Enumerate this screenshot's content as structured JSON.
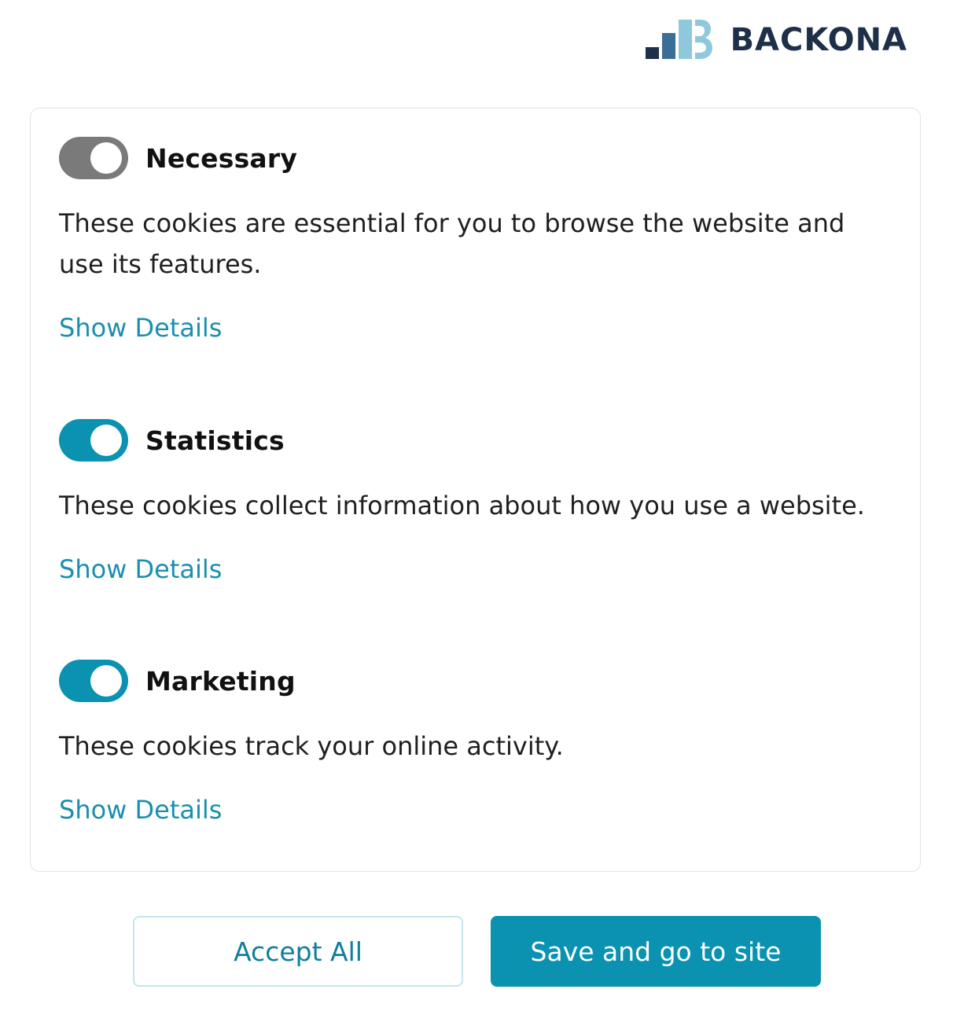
{
  "brand": {
    "logo_text": "BACKONA",
    "logo_icon": "bar-chart-b-icon",
    "colors": {
      "dark_navy": "#1e2f49",
      "mid_blue": "#3a6e99",
      "light_blue": "#8fc8dc"
    }
  },
  "categories": [
    {
      "title": "Necessary",
      "description": "These cookies are essential for you to browse the website and use its features.",
      "link": "Show Details",
      "toggle_state": "on-disabled"
    },
    {
      "title": "Statistics",
      "description": "These cookies collect information about how you use a website.",
      "link": "Show Details",
      "toggle_state": "on"
    },
    {
      "title": "Marketing",
      "description": "These cookies track your online activity.",
      "link": "Show Details",
      "toggle_state": "on"
    }
  ],
  "buttons": {
    "accept_all": "Accept All",
    "save": "Save and go to site"
  },
  "colors": {
    "accent": "#0a92b0",
    "link": "#1a8fad",
    "toggle_disabled": "#7a7a7a",
    "panel_border": "#e2e2e2"
  }
}
